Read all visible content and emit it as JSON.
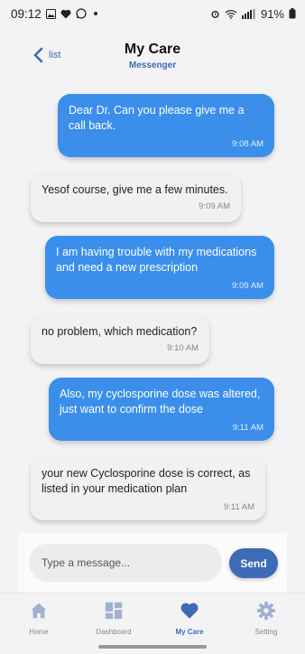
{
  "status_bar": {
    "time": "09:12",
    "battery": "91%",
    "icons": [
      "image-icon",
      "heart-icon",
      "whatsapp-icon",
      "alarm-icon",
      "wifi-icon",
      "signal-icon",
      "battery-icon"
    ]
  },
  "header": {
    "back_label": "list",
    "title": "My Care",
    "subtitle": "Messenger"
  },
  "messages": [
    {
      "direction": "out",
      "text": "Dear Dr. Can you please give me a call back.",
      "time": "9:08 AM"
    },
    {
      "direction": "in",
      "text": "Yesof course, give me a few minutes.",
      "time": "9:09 AM"
    },
    {
      "direction": "out",
      "text": "I am having trouble with my medications and need a new prescription",
      "time": "9:09 AM"
    },
    {
      "direction": "in",
      "text": "no problem, which medication?",
      "time": "9:10 AM"
    },
    {
      "direction": "out",
      "text": "Also, my cyclosporine dose was altered, just want to confirm the dose",
      "time": "9:11 AM"
    },
    {
      "direction": "in",
      "text": "your new Cyclosporine dose is correct, as listed in your medication plan",
      "time": "9:11 AM"
    }
  ],
  "composer": {
    "placeholder": "Type a message...",
    "value": "",
    "send_label": "Send"
  },
  "nav": {
    "items": [
      {
        "label": "Home",
        "icon": "home-icon",
        "active": false
      },
      {
        "label": "Dashboard",
        "icon": "dashboard-icon",
        "active": false
      },
      {
        "label": "My Care",
        "icon": "heart-icon",
        "active": true
      },
      {
        "label": "Setting",
        "icon": "gear-icon",
        "active": false
      }
    ]
  },
  "colors": {
    "accent": "#3e6bb5",
    "outgoing_bubble": "#3b8fea",
    "incoming_bubble": "#f1f1f1",
    "inactive_nav": "#9fb1cf"
  }
}
